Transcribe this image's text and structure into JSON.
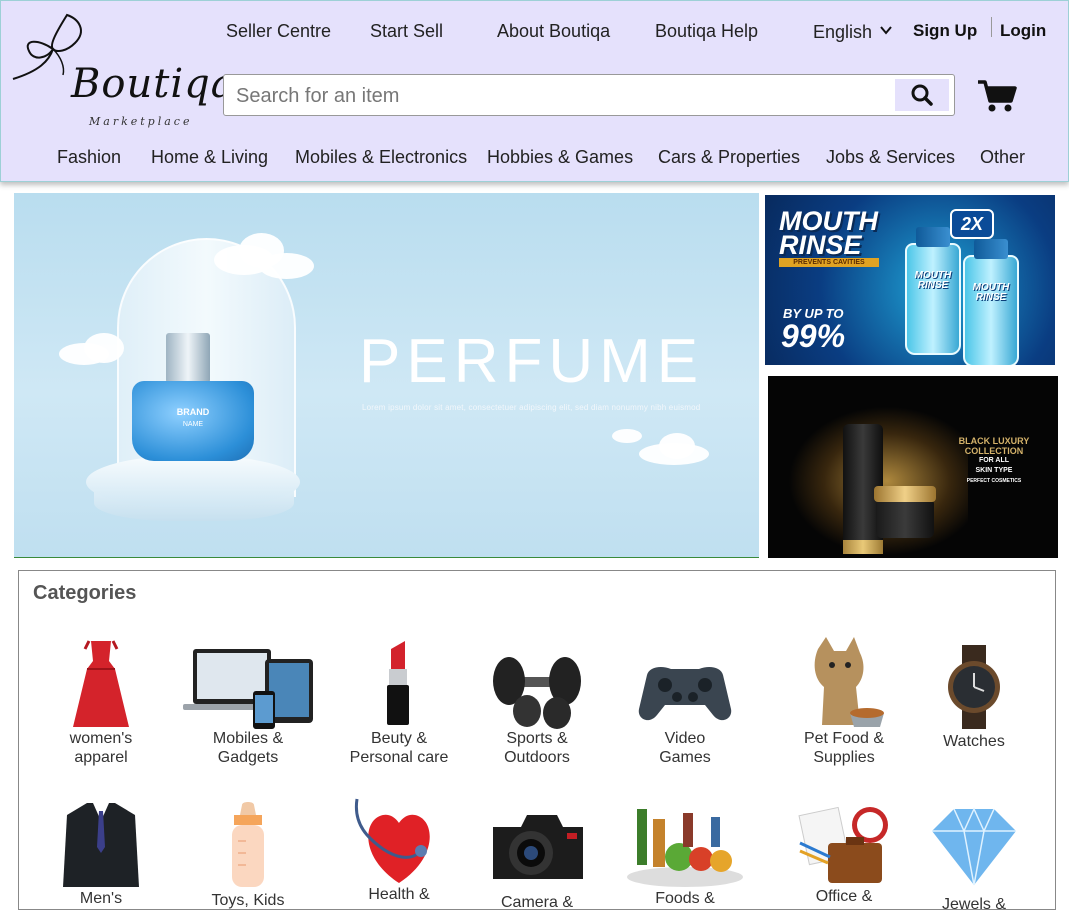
{
  "header": {
    "logo": {
      "name": "Boutiqa",
      "sub": "Marketplace"
    },
    "top_links": [
      "Seller Centre",
      "Start Sell",
      "About Boutiqa",
      "Boutiqa Help"
    ],
    "language": "English",
    "sign_up": "Sign Up",
    "login": "Login",
    "search": {
      "placeholder": "Search for an item"
    },
    "nav": [
      "Fashion",
      "Home & Living",
      "Mobiles & Electronics",
      "Hobbies & Games",
      "Cars & Properties",
      "Jobs & Services",
      "Other"
    ]
  },
  "banners": {
    "main": {
      "title": "PERFUME",
      "subtitle": "Lorem ipsum dolor sit amet, consectetuer adipiscing elit, sed diam nonummy nibh euismod",
      "bottle_brand": "BRAND",
      "bottle_name": "NAME"
    },
    "top_right": {
      "title_1": "MOUTH",
      "title_2": "RINSE",
      "strip": "PREVENTS CAVITIES",
      "multiplier": "2X",
      "by_up_to": "BY UP TO",
      "percent": "99%",
      "bottle_label": "MOUTH RINSE"
    },
    "bottom_right": {
      "line1": "BLACK LUXURY",
      "line2": "COLLECTION",
      "line3": "FOR ALL",
      "line4": "SKIN TYPE",
      "line5": "PERFECT COSMETICS"
    }
  },
  "categories": {
    "title": "Categories",
    "row1": [
      {
        "label1": "women's",
        "label2": "apparel",
        "icon": "dress-icon"
      },
      {
        "label1": "Mobiles &",
        "label2": "Gadgets",
        "icon": "devices-icon"
      },
      {
        "label1": "Beuty &",
        "label2": "Personal care",
        "icon": "lipstick-icon"
      },
      {
        "label1": "Sports &",
        "label2": "Outdoors",
        "icon": "dumbbell-icon"
      },
      {
        "label1": "Video",
        "label2": "Games",
        "icon": "gamepad-icon"
      },
      {
        "label1": "Pet Food &",
        "label2": "Supplies",
        "icon": "kitten-icon"
      },
      {
        "label1": "Watches",
        "label2": "",
        "icon": "watch-icon"
      }
    ],
    "row2": [
      {
        "label1": "Men's",
        "icon": "suit-icon"
      },
      {
        "label1": "Toys, Kids",
        "icon": "baby-bottle-icon"
      },
      {
        "label1": "Health &",
        "icon": "heart-stethoscope-icon"
      },
      {
        "label1": "Camera &",
        "icon": "camera-icon"
      },
      {
        "label1": "Foods &",
        "icon": "groceries-icon"
      },
      {
        "label1": "Office &",
        "icon": "office-icon"
      },
      {
        "label1": "Jewels &",
        "icon": "diamond-icon"
      }
    ]
  },
  "colors": {
    "header_bg": "#e5e1fc",
    "header_border": "#9dd0d6",
    "banner_sky": "#b9ddef"
  }
}
